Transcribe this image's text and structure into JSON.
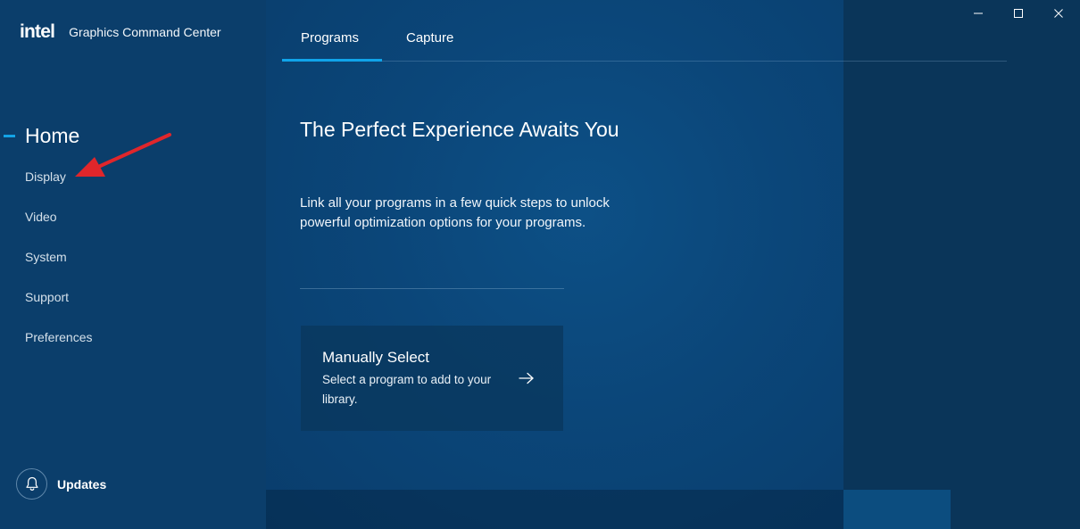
{
  "app": {
    "logo_text": "intel",
    "title": "Graphics Command Center"
  },
  "sidebar": {
    "home_label": "Home",
    "items": [
      {
        "label": "Display"
      },
      {
        "label": "Video"
      },
      {
        "label": "System"
      },
      {
        "label": "Support"
      },
      {
        "label": "Preferences"
      }
    ],
    "updates_label": "Updates"
  },
  "tabs": [
    {
      "label": "Programs",
      "selected": true
    },
    {
      "label": "Capture",
      "selected": false
    }
  ],
  "main": {
    "headline": "The Perfect Experience Awaits You",
    "description": "Link all your programs in a few quick steps to unlock powerful optimization options for your programs.",
    "card": {
      "title": "Manually Select",
      "description": "Select a program to add to your library."
    }
  },
  "icons": {
    "bell": "bell-icon",
    "card_arrow": "arrow-right-icon",
    "minimize": "minimize-icon",
    "maximize": "maximize-icon",
    "close": "close-icon",
    "annotation": "red-pointer-arrow"
  },
  "colors": {
    "accent": "#10a4ea",
    "background": "#0b4679",
    "annotation": "#e0262b"
  }
}
